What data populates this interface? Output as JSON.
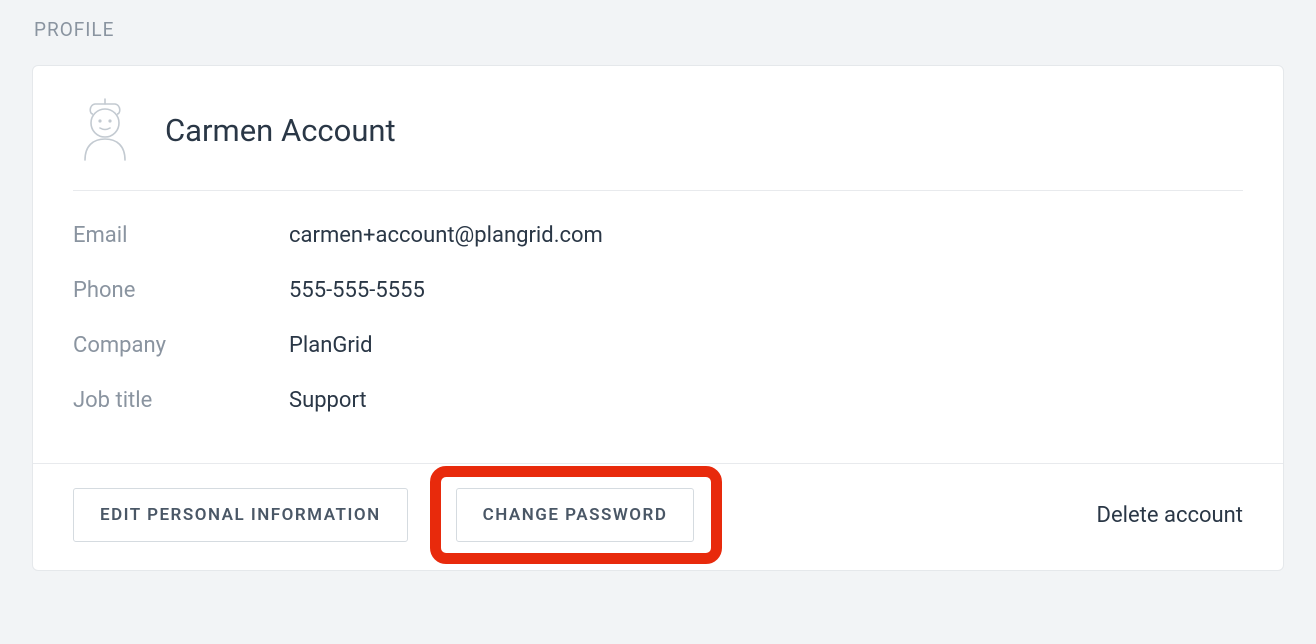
{
  "section": {
    "title": "PROFILE"
  },
  "profile": {
    "name": "Carmen Account",
    "fields": {
      "email": {
        "label": "Email",
        "value": "carmen+account@plangrid.com"
      },
      "phone": {
        "label": "Phone",
        "value": "555-555-5555"
      },
      "company": {
        "label": "Company",
        "value": "PlanGrid"
      },
      "job_title": {
        "label": "Job title",
        "value": "Support"
      }
    }
  },
  "actions": {
    "edit_personal": "EDIT PERSONAL INFORMATION",
    "change_password": "CHANGE PASSWORD",
    "delete_account": "Delete account"
  }
}
